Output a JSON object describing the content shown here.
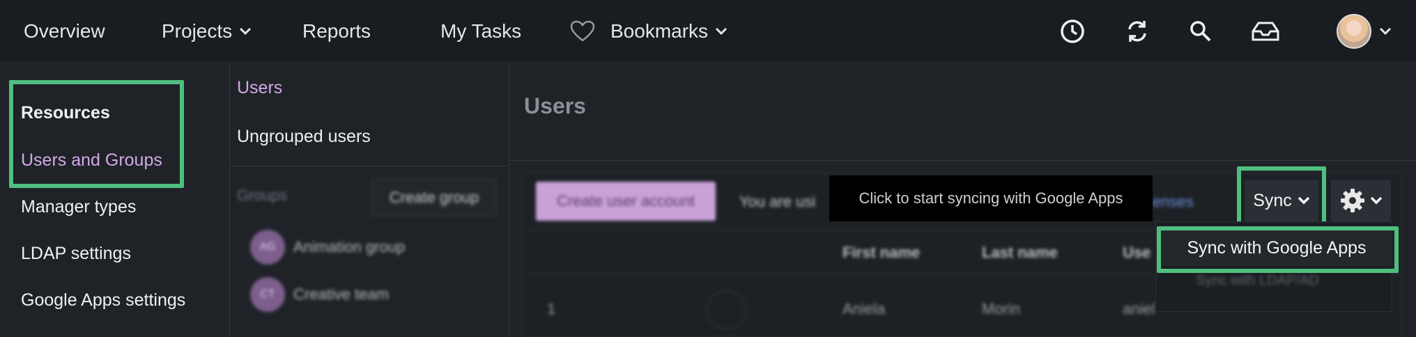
{
  "topnav": {
    "items": [
      {
        "label": "Overview"
      },
      {
        "label": "Projects"
      },
      {
        "label": "Reports"
      },
      {
        "label": "My Tasks"
      },
      {
        "label": "Bookmarks"
      }
    ],
    "icons": [
      "heart-icon",
      "clock-icon",
      "sync-icon",
      "search-icon",
      "inbox-icon",
      "avatar",
      "chevron-down-icon"
    ]
  },
  "sidebar": {
    "heading": "Resources",
    "items": [
      {
        "label": "Users and Groups",
        "active": true
      },
      {
        "label": "Manager types"
      },
      {
        "label": "LDAP settings"
      },
      {
        "label": "Google Apps settings"
      }
    ]
  },
  "midpanel": {
    "items": [
      {
        "label": "Users",
        "active": true
      },
      {
        "label": "Ungrouped users"
      }
    ],
    "groups_label": "Groups",
    "create_group": "Create group",
    "groups": [
      {
        "badge": "AG",
        "name": "Animation group"
      },
      {
        "badge": "CT",
        "name": "Creative team"
      }
    ]
  },
  "main": {
    "title": "Users",
    "create_user": "Create user account",
    "using_text": "You are usi",
    "licenses_text": "enses",
    "columns": [
      "First name",
      "Last name",
      "Use"
    ],
    "rows": [
      {
        "num": "1",
        "first": "Aniela",
        "last": "Morin",
        "user": "aniel"
      }
    ],
    "tooltip": "Click to start syncing with Google Apps",
    "sync_label": "Sync",
    "dropdown": [
      {
        "label": "Sync with Google Apps"
      },
      {
        "label": "Sync with LDAP/AD"
      }
    ]
  },
  "colors": {
    "highlight": "#4fbf7f",
    "accent": "#d4a8e6",
    "button_primary": "#c9a1d9"
  }
}
